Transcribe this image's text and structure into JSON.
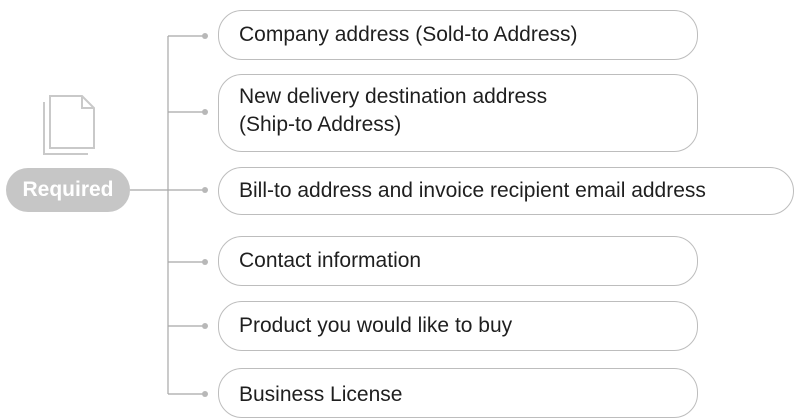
{
  "diagram": {
    "root": {
      "label": "Required",
      "icon": "document-icon"
    },
    "items": [
      {
        "label": "Company  address  (Sold-to  Address)"
      },
      {
        "label": "New delivery destination address\n(Ship-to  Address)"
      },
      {
        "label": "Bill-to address and invoice recipient email address"
      },
      {
        "label": "Contact  information"
      },
      {
        "label": "Product you would like to buy"
      },
      {
        "label": "Business  License"
      }
    ],
    "colors": {
      "connector": "#a8a8a8",
      "pill_fill": "#c6c6c6",
      "box_border": "#bdbdbd",
      "text": "#1f1f1f"
    }
  }
}
